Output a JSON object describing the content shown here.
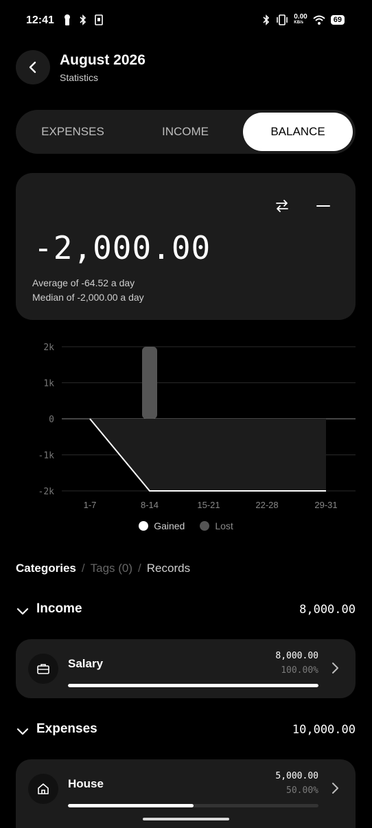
{
  "status_bar": {
    "time": "12:41",
    "net_speed": "0.00",
    "net_unit": "KB/s",
    "battery": "69"
  },
  "header": {
    "title": "August 2026",
    "subtitle": "Statistics"
  },
  "tabs": [
    {
      "label": "EXPENSES",
      "active": false
    },
    {
      "label": "INCOME",
      "active": false
    },
    {
      "label": "BALANCE",
      "active": true
    }
  ],
  "balance": {
    "amount": "-2,000.00",
    "average": "Average of -64.52 a day",
    "median": "Median of -2,000.00 a day"
  },
  "chart_data": {
    "type": "area",
    "categories": [
      "1-7",
      "8-14",
      "15-21",
      "22-28",
      "29-31"
    ],
    "y_ticks": [
      "2k",
      "1k",
      "0",
      "-1k",
      "-2k"
    ],
    "ylim": [
      -2000,
      2000
    ],
    "grid": true,
    "series": [
      {
        "name": "Gained",
        "kind": "line",
        "values": [
          0,
          -2000,
          -2000,
          -2000,
          -2000
        ]
      },
      {
        "name": "Lost",
        "kind": "bar",
        "values": [
          0,
          2000,
          0,
          0,
          0
        ]
      }
    ],
    "legend_position": "bottom",
    "colors": {
      "gained": "#ffffff",
      "lost": "#555555",
      "area": "#1c1c1c"
    }
  },
  "breadcrumbs": {
    "categories": "Categories",
    "tags": "Tags (0)",
    "records": "Records",
    "separator": "/"
  },
  "sections": {
    "income": {
      "title": "Income",
      "total": "8,000.00",
      "items": [
        {
          "name": "Salary",
          "icon": "briefcase-icon",
          "amount": "8,000.00",
          "percent": "100.00%",
          "fraction": 1.0
        }
      ]
    },
    "expenses": {
      "title": "Expenses",
      "total": "10,000.00",
      "items": [
        {
          "name": "House",
          "icon": "home-icon",
          "amount": "5,000.00",
          "percent": "50.00%",
          "fraction": 0.5
        }
      ]
    }
  }
}
